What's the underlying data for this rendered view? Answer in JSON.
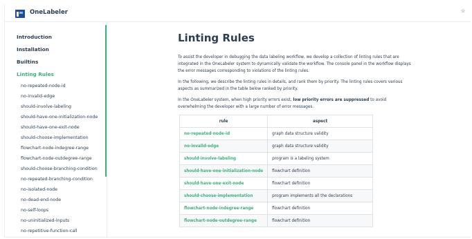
{
  "app": {
    "title": "OneLabeler",
    "theme_toggle": "☼"
  },
  "sidebar": {
    "sections": [
      "Introduction",
      "Installation",
      "Builtins",
      "Linting Rules"
    ],
    "active_section": "Linting Rules",
    "sub_items": [
      "no-repeated-node-id",
      "no-invalid-edge",
      "should-involve-labeling",
      "should-have-one-initialization-node",
      "should-have-one-exit-node",
      "should-choose-implementation",
      "flowchart-node-indegree-range",
      "flowchart-node-outdegree-range",
      "should-choose-branching-condition",
      "no-repeated-branching-condition",
      "no-isolated-node",
      "no-dead-end-node",
      "no-self-loops",
      "no-uninitialized-inputs",
      "no-repetitive-function-call"
    ]
  },
  "main": {
    "title": "Linting Rules",
    "para1": "To assist the developer in debugging the data labeling workflow, we develop a collection of linting rules that are integrated in the OneLabeler system to dynamically validate the workflow. The console panel in the workflow displays the error messages corresponding to violations of the linting rules.",
    "para2": "In the following, we describe the linting rules in details, and rank them by priority. The linting rules covers various aspects as summarized in the table below ranked by priority.",
    "para3_pre": "In the OneLabeler system, when high priority errors exist, ",
    "para3_bold": "low priority errors are suppressed",
    "para3_post": " to avoid overwhelming the developer with a large number of error messages.",
    "table": {
      "headers": [
        "rule",
        "aspect"
      ],
      "rows": [
        {
          "rule": "no-repeated-node-id",
          "aspect": "graph data structure validity"
        },
        {
          "rule": "no-invalid-edge",
          "aspect": "graph data structure validity"
        },
        {
          "rule": "should-involve-labeling",
          "aspect": "program is a labeling system"
        },
        {
          "rule": "should-have-one-initialization-node",
          "aspect": "flowchart definition"
        },
        {
          "rule": "should-have-one-exit-node",
          "aspect": "flowchart definition"
        },
        {
          "rule": "should-choose-implementation",
          "aspect": "program implements all the declarations"
        },
        {
          "rule": "flowchart-node-indegree-range",
          "aspect": "flowchart definition"
        },
        {
          "rule": "flowchart-node-outdegree-range",
          "aspect": "flowchart definition"
        }
      ]
    }
  }
}
